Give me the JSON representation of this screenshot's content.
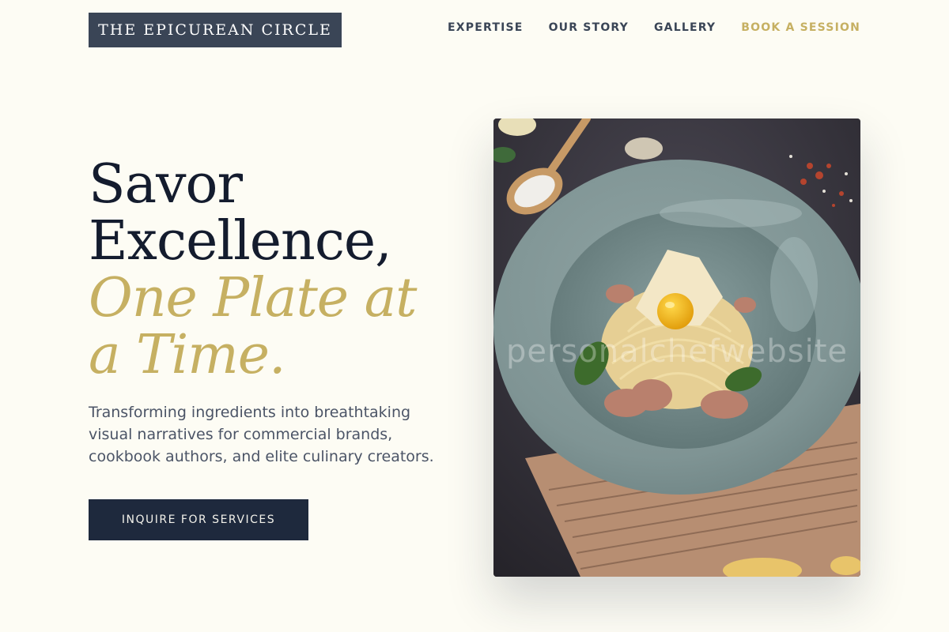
{
  "header": {
    "logo": "THE EPICUREAN CIRCLE",
    "nav": [
      {
        "label": "EXPERTISE"
      },
      {
        "label": "OUR STORY"
      },
      {
        "label": "GALLERY"
      },
      {
        "label": "BOOK A SESSION"
      }
    ]
  },
  "hero": {
    "title_line1": "Savor",
    "title_line2": "Excellence,",
    "title_accent": "One Plate at a Time.",
    "subtitle": "Transforming ingredients into breathtaking visual narratives for commercial brands, cookbook authors, and elite culinary creators.",
    "button_label": "INQUIRE FOR SERVICES"
  },
  "photo": {
    "watermark": "personalchefwebsite"
  },
  "colors": {
    "background": "#fdfcf4",
    "navy": "#1e293d",
    "gold": "#c6b062",
    "logo_bg": "#3a4556"
  }
}
